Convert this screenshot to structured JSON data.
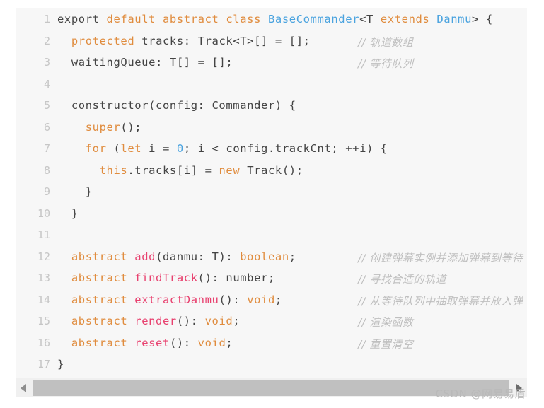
{
  "editor": {
    "language": "typescript",
    "background_color": "#f7f7f7",
    "page_background_color": "#ffffff",
    "gutter_color": "#c6c6c6",
    "text_color": "#444444",
    "keyword_color": "#e08c3e",
    "type_color": "#4aa3df",
    "function_color": "#e8416f",
    "comment_color": "#bfbfbf",
    "lines": [
      {
        "number": "1",
        "tokens": [
          {
            "text": "export ",
            "kind": "plain"
          },
          {
            "text": "default abstract class ",
            "kind": "kw"
          },
          {
            "text": "BaseCommander",
            "kind": "type"
          },
          {
            "text": "<T ",
            "kind": "plain"
          },
          {
            "text": "extends ",
            "kind": "kw"
          },
          {
            "text": "Danmu",
            "kind": "type"
          },
          {
            "text": "> {",
            "kind": "plain"
          }
        ],
        "comment": ""
      },
      {
        "number": "2",
        "tokens": [
          {
            "text": "  ",
            "kind": "plain"
          },
          {
            "text": "protected ",
            "kind": "kw"
          },
          {
            "text": "tracks: Track<T>[] = [];",
            "kind": "plain"
          }
        ],
        "comment": "// 轨道数组"
      },
      {
        "number": "3",
        "tokens": [
          {
            "text": "  waitingQueue: T[] = [];",
            "kind": "plain"
          }
        ],
        "comment": "// 等待队列"
      },
      {
        "number": "4",
        "tokens": [],
        "comment": ""
      },
      {
        "number": "5",
        "tokens": [
          {
            "text": "  constructor(config: Commander) {",
            "kind": "plain"
          }
        ],
        "comment": ""
      },
      {
        "number": "6",
        "tokens": [
          {
            "text": "    ",
            "kind": "plain"
          },
          {
            "text": "super",
            "kind": "kw"
          },
          {
            "text": "();",
            "kind": "plain"
          }
        ],
        "comment": ""
      },
      {
        "number": "7",
        "tokens": [
          {
            "text": "    ",
            "kind": "plain"
          },
          {
            "text": "for ",
            "kind": "kw"
          },
          {
            "text": "(",
            "kind": "plain"
          },
          {
            "text": "let ",
            "kind": "kw"
          },
          {
            "text": "i = ",
            "kind": "plain"
          },
          {
            "text": "0",
            "kind": "num"
          },
          {
            "text": "; i < config.trackCnt; ++i) {",
            "kind": "plain"
          }
        ],
        "comment": ""
      },
      {
        "number": "8",
        "tokens": [
          {
            "text": "      ",
            "kind": "plain"
          },
          {
            "text": "this",
            "kind": "kw"
          },
          {
            "text": ".tracks[i] = ",
            "kind": "plain"
          },
          {
            "text": "new ",
            "kind": "kw"
          },
          {
            "text": "Track();",
            "kind": "plain"
          }
        ],
        "comment": ""
      },
      {
        "number": "9",
        "tokens": [
          {
            "text": "    }",
            "kind": "plain"
          }
        ],
        "comment": ""
      },
      {
        "number": "10",
        "tokens": [
          {
            "text": "  }",
            "kind": "plain"
          }
        ],
        "comment": ""
      },
      {
        "number": "11",
        "tokens": [],
        "comment": ""
      },
      {
        "number": "12",
        "tokens": [
          {
            "text": "  ",
            "kind": "plain"
          },
          {
            "text": "abstract ",
            "kind": "kw"
          },
          {
            "text": "add",
            "kind": "fn"
          },
          {
            "text": "(danmu: T): ",
            "kind": "plain"
          },
          {
            "text": "boolean",
            "kind": "kw"
          },
          {
            "text": ";",
            "kind": "plain"
          }
        ],
        "comment": "// 创建弹幕实例并添加弹幕到等待"
      },
      {
        "number": "13",
        "tokens": [
          {
            "text": "  ",
            "kind": "plain"
          },
          {
            "text": "abstract ",
            "kind": "kw"
          },
          {
            "text": "findTrack",
            "kind": "fn"
          },
          {
            "text": "(): number;",
            "kind": "plain"
          }
        ],
        "comment": "// 寻找合适的轨道"
      },
      {
        "number": "14",
        "tokens": [
          {
            "text": "  ",
            "kind": "plain"
          },
          {
            "text": "abstract ",
            "kind": "kw"
          },
          {
            "text": "extractDanmu",
            "kind": "fn"
          },
          {
            "text": "(): ",
            "kind": "plain"
          },
          {
            "text": "void",
            "kind": "kw"
          },
          {
            "text": ";",
            "kind": "plain"
          }
        ],
        "comment": "// 从等待队列中抽取弹幕并放入弹"
      },
      {
        "number": "15",
        "tokens": [
          {
            "text": "  ",
            "kind": "plain"
          },
          {
            "text": "abstract ",
            "kind": "kw"
          },
          {
            "text": "render",
            "kind": "fn"
          },
          {
            "text": "(): ",
            "kind": "plain"
          },
          {
            "text": "void",
            "kind": "kw"
          },
          {
            "text": ";",
            "kind": "plain"
          }
        ],
        "comment": "// 渲染函数"
      },
      {
        "number": "16",
        "tokens": [
          {
            "text": "  ",
            "kind": "plain"
          },
          {
            "text": "abstract ",
            "kind": "kw"
          },
          {
            "text": "reset",
            "kind": "fn"
          },
          {
            "text": "(): ",
            "kind": "plain"
          },
          {
            "text": "void",
            "kind": "kw"
          },
          {
            "text": ";",
            "kind": "plain"
          }
        ],
        "comment": "// 重置清空"
      },
      {
        "number": "17",
        "tokens": [
          {
            "text": "}",
            "kind": "plain"
          }
        ],
        "comment": ""
      }
    ]
  },
  "scrollbar": {
    "orientation": "horizontal",
    "left_arrow_icon": "chevron-left-icon",
    "right_arrow_icon": "chevron-right-icon",
    "thumb_color": "#c0c0c0",
    "track_color": "#f0f0f0"
  },
  "watermark": {
    "text": "CSDN @网易易盾"
  }
}
